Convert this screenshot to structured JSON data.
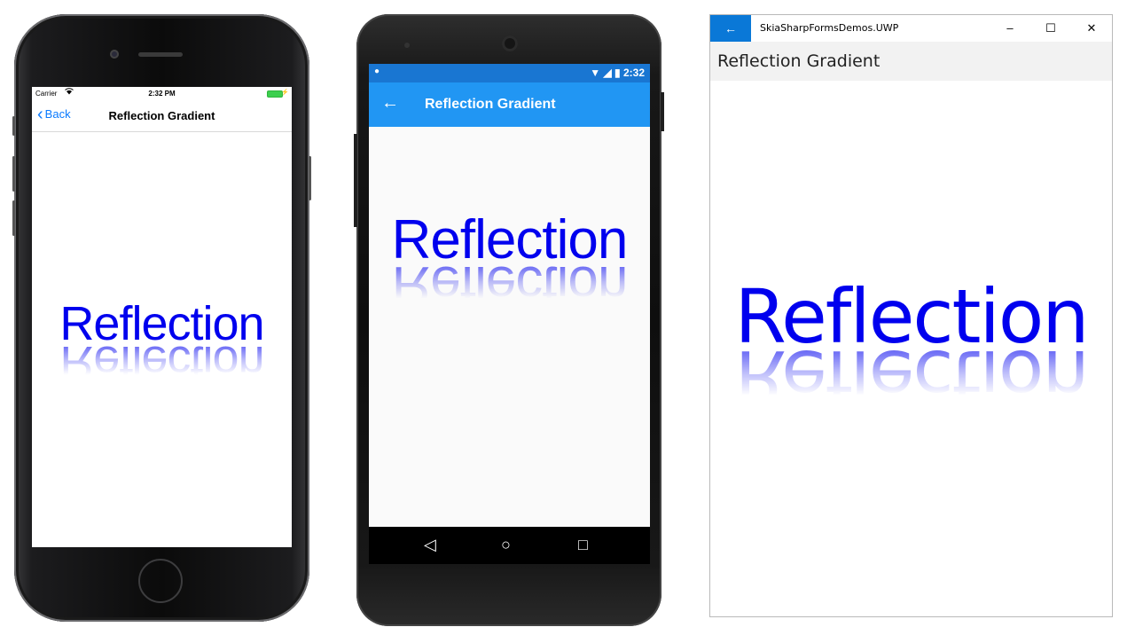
{
  "reflection_text": "Reflection",
  "colors": {
    "text": "#0000ee",
    "ios_accent": "#0a7aff",
    "android_primary": "#2196f3",
    "android_status": "#1976d2",
    "uwp_accent": "#0a78d7"
  },
  "iphone": {
    "status": {
      "carrier": "Carrier",
      "time": "2:32 PM"
    },
    "nav": {
      "back_label": "Back",
      "title": "Reflection Gradient"
    }
  },
  "android": {
    "status": {
      "time": "2:32"
    },
    "toolbar": {
      "title": "Reflection Gradient"
    },
    "navbar": {
      "back_icon": "◁",
      "home_icon": "○",
      "recents_icon": "□"
    }
  },
  "uwp": {
    "app_title": "SkiaSharpFormsDemos.UWP",
    "page_title": "Reflection Gradient",
    "controls": {
      "minimize": "–",
      "maximize": "☐",
      "close": "✕"
    }
  }
}
